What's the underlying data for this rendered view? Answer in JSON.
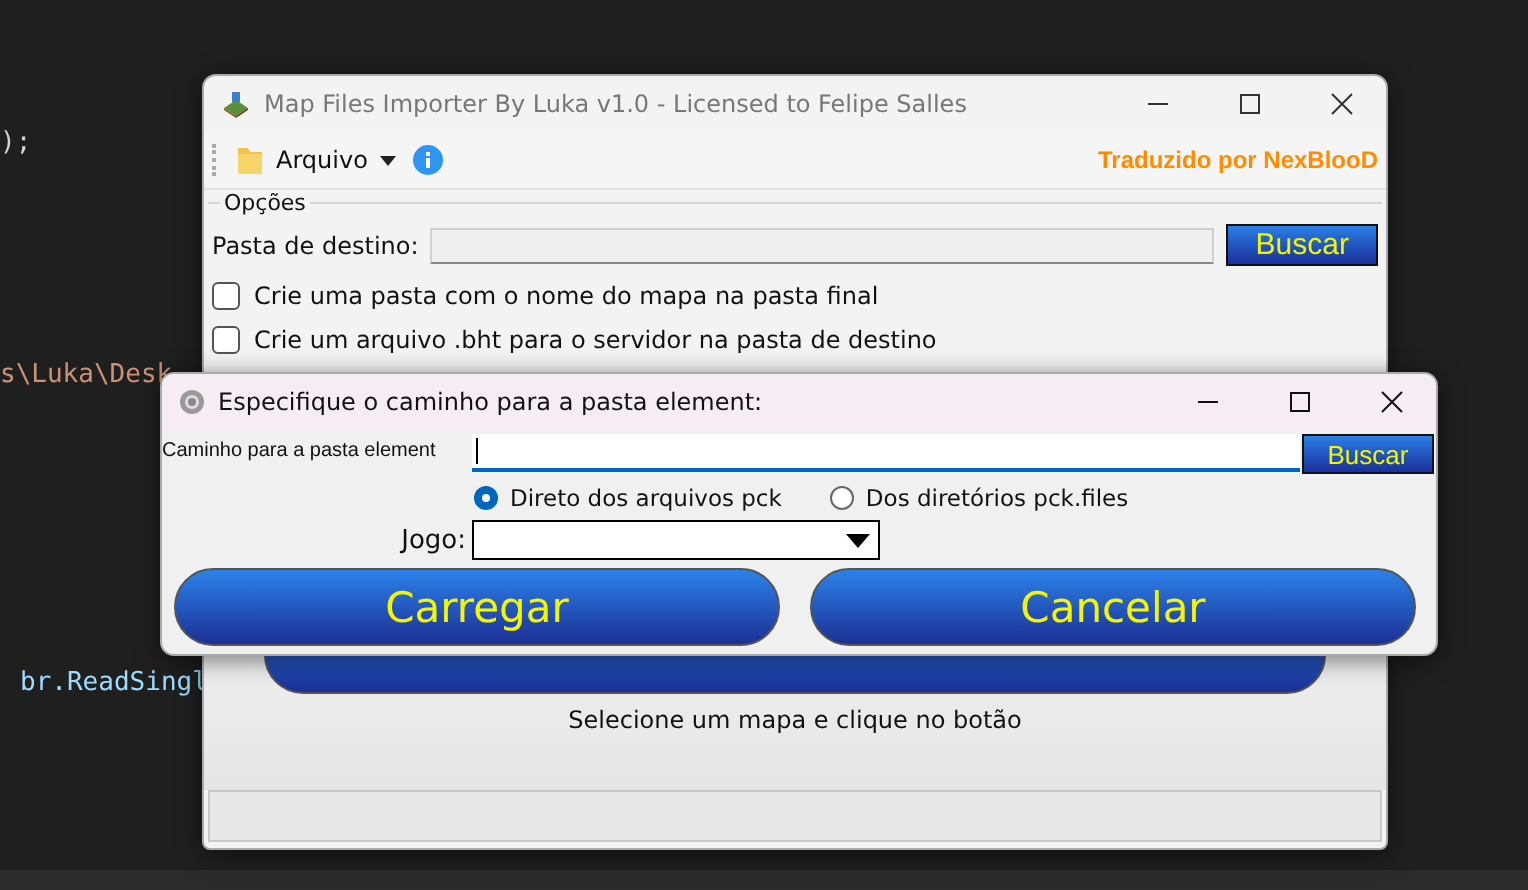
{
  "background_code": [
    {
      "text": ");",
      "kind": "plain"
    },
    {
      "text": "s\\Luka\\Desk",
      "kind": "string"
    },
    {
      "text": "br.ReadSingl",
      "kind": "call"
    }
  ],
  "main_window": {
    "title": "Map Files Importer By Luka v1.0 - Licensed to Felipe Salles",
    "menu": {
      "label": "Arquivo"
    },
    "credit": "Traduzido por NexBlooD",
    "group_label": "Opções",
    "destination": {
      "label": "Pasta de destino:",
      "button": "Buscar"
    },
    "options": [
      {
        "label": "Crie uma pasta com o nome do mapa na pasta final",
        "checked": false
      },
      {
        "label": "Crie um arquivo .bht para o servidor na pasta de destino",
        "checked": false
      }
    ],
    "status_text": "Selecione um mapa e clique no botão"
  },
  "dialog": {
    "title": "Especifique o caminho para a pasta element:",
    "path": {
      "label": "Caminho para a pasta element",
      "button": "Buscar"
    },
    "sources": [
      {
        "label": "Direto dos arquivos pck",
        "selected": true
      },
      {
        "label": "Dos diretórios pck.files",
        "selected": false
      }
    ],
    "game": {
      "label": "Jogo:"
    },
    "buttons": [
      "Carregar",
      "Cancelar"
    ]
  }
}
